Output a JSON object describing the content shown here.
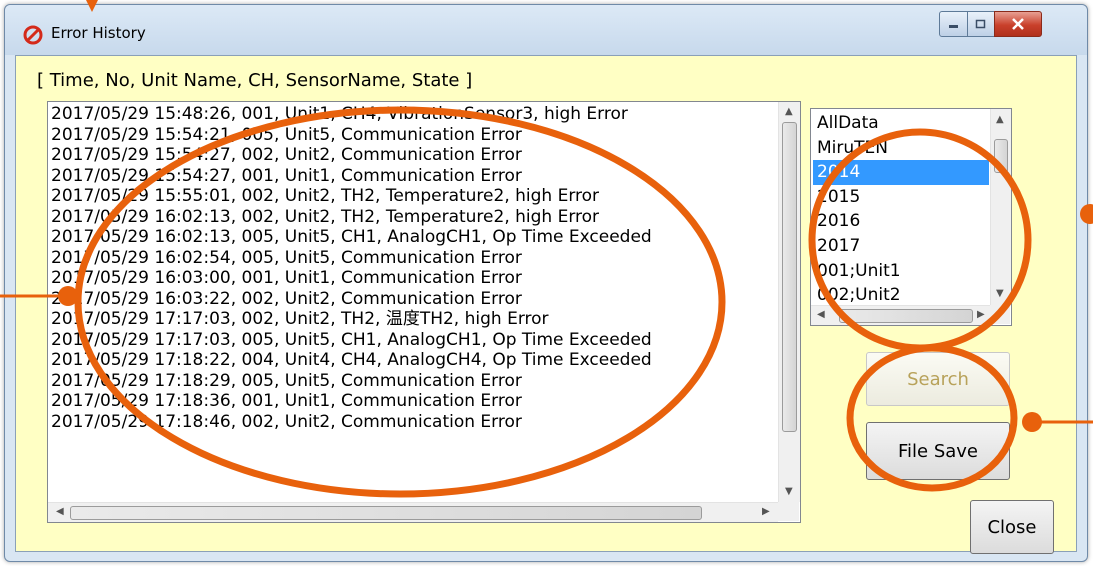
{
  "window": {
    "title": "Error History",
    "controls": [
      "minimize",
      "maximize",
      "close"
    ]
  },
  "header_label": "[ Time, No, Unit Name, CH, SensorName, State ]",
  "log": {
    "entries": [
      "2017/05/29 15:48:26, 001, Unit1, CH4, VibrationSensor3, high Error",
      "2017/05/29 15:54:21, 005, Unit5, Communication Error",
      "2017/05/29 15:54:27, 002, Unit2, Communication Error",
      "2017/05/29 15:54:27, 001, Unit1, Communication Error",
      "2017/05/29 15:55:01, 002, Unit2, TH2, Temperature2, high Error",
      "2017/05/29 16:02:13, 002, Unit2, TH2, Temperature2, high Error",
      "2017/05/29 16:02:13, 005, Unit5, CH1, AnalogCH1, Op Time Exceeded",
      "2017/05/29 16:02:54, 005, Unit5, Communication Error",
      "2017/05/29 16:03:00, 001, Unit1, Communication Error",
      "2017/05/29 16:03:22, 002, Unit2, Communication Error",
      "2017/05/29 17:17:03, 002, Unit2, TH2, 温度TH2, high Error",
      "2017/05/29 17:17:03, 005, Unit5, CH1, AnalogCH1, Op Time Exceeded",
      "2017/05/29 17:18:22, 004, Unit4, CH4, AnalogCH4, Op Time Exceeded",
      "2017/05/29 17:18:29, 005, Unit5, Communication Error",
      "2017/05/29 17:18:36, 001, Unit1, Communication Error",
      "2017/05/29 17:18:46, 002, Unit2, Communication Error"
    ]
  },
  "filter": {
    "items": [
      "AllData",
      "MiruTEN",
      "2014",
      "2015",
      "2016",
      "2017",
      "001;Unit1",
      "002;Unit2"
    ],
    "selected": "2014",
    "selected_color": "#3399ff"
  },
  "buttons": {
    "search": "Search",
    "file_save": "File Save",
    "close": "Close"
  },
  "annotation_color": "#e8610c"
}
